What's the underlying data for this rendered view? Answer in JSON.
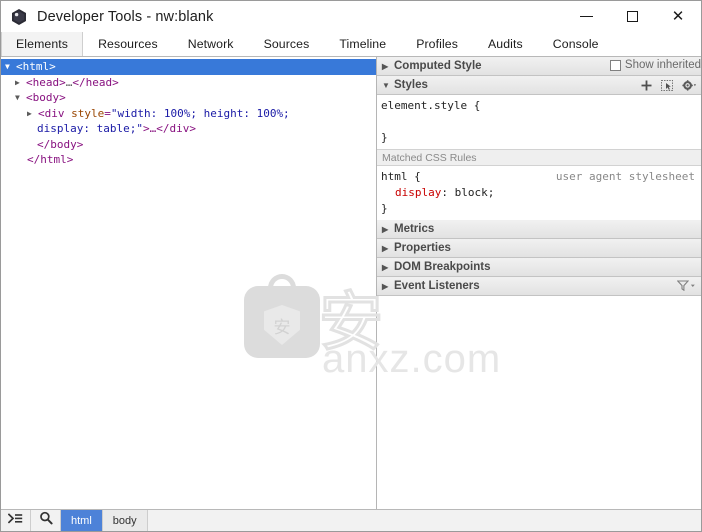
{
  "window": {
    "title": "Developer Tools - nw:blank",
    "app_icon": "nwjs-hexagon-icon",
    "controls": {
      "minimize": "minimize-icon",
      "maximize": "maximize-icon",
      "close": "close-icon"
    }
  },
  "tabs": [
    {
      "label": "Elements",
      "active": true
    },
    {
      "label": "Resources",
      "active": false
    },
    {
      "label": "Network",
      "active": false
    },
    {
      "label": "Sources",
      "active": false
    },
    {
      "label": "Timeline",
      "active": false
    },
    {
      "label": "Profiles",
      "active": false
    },
    {
      "label": "Audits",
      "active": false
    },
    {
      "label": "Console",
      "active": false
    }
  ],
  "dom_tree": {
    "rows": [
      {
        "arrow": "▼",
        "text": "<html>",
        "selected": true
      },
      {
        "arrow": "▶",
        "text": "<head>…</head>",
        "selected": false
      },
      {
        "arrow": "▼",
        "text": "<body>",
        "selected": false
      },
      {
        "arrow": "▶",
        "text": "<div style=\"width: 100%; height: 100%;",
        "selected": false
      },
      {
        "arrow": "",
        "text": "display: table;\">…</div>",
        "selected": false
      },
      {
        "arrow": "",
        "text": "</body>",
        "selected": false
      },
      {
        "arrow": "",
        "text": "</html>",
        "selected": false
      }
    ],
    "div_tag_open": "<div",
    "div_attr_name": "style",
    "div_attr_value1": "\"width: 100%; height: 100%;",
    "div_attr_value2": "display: table;\"",
    "div_tail": ">…</div>",
    "head_open": "<head>",
    "head_close": "</head>",
    "html_open": "<html>",
    "html_close": "</html>",
    "body_open": "<body>",
    "body_close": "</body>",
    "ellipsis": "…"
  },
  "sidebar": {
    "computed_style": {
      "label": "Computed Style",
      "triangle": "▶",
      "show_inherited_label": "Show inherited",
      "show_inherited_checked": false
    },
    "styles": {
      "label": "Styles",
      "triangle": "▼",
      "tools": {
        "new_rule": "plus-icon",
        "element_state": "element-state-icon",
        "settings": "gear-icon"
      },
      "element_style": {
        "selector": "element.style {",
        "close": "}"
      },
      "matched_label": "Matched CSS Rules",
      "rules": [
        {
          "selector": "html {",
          "source": "user agent stylesheet",
          "declarations": [
            {
              "name": "display",
              "value": "block;"
            }
          ],
          "close": "}"
        }
      ]
    },
    "sections": [
      {
        "label": "Metrics",
        "triangle": "▶",
        "filter": false
      },
      {
        "label": "Properties",
        "triangle": "▶",
        "filter": false
      },
      {
        "label": "DOM Breakpoints",
        "triangle": "▶",
        "filter": false
      },
      {
        "label": "Event Listeners",
        "triangle": "▶",
        "filter": true
      }
    ]
  },
  "statusbar": {
    "console_toggle": "console-drawer-icon",
    "search": "search-icon",
    "breadcrumbs": [
      {
        "label": "html",
        "active": true
      },
      {
        "label": "body",
        "active": false
      }
    ]
  },
  "watermark": {
    "glyph": "安",
    "shield_glyph": "安",
    "text": "anxz.com"
  },
  "colors": {
    "selection_blue": "#3879d9",
    "crumb_active": "#4d82d8",
    "tag_purple": "#881280",
    "attr_name_orange": "#994500",
    "attr_value_blue": "#1a1aa6",
    "prop_name_red": "#c80000",
    "panel_border": "#b8b8b8"
  }
}
